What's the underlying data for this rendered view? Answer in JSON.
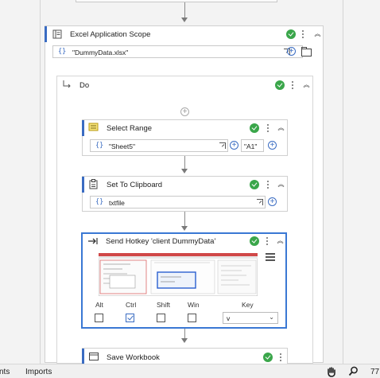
{
  "colors": {
    "accent": "#3a6cc2",
    "success": "#3aa64a",
    "selected_border": "#3a78d4"
  },
  "excel_scope": {
    "title": "Excel Application Scope",
    "path_value": "\"DummyData.xlsx\"",
    "brace": "{}"
  },
  "do_block": {
    "title": "Do"
  },
  "select_range": {
    "title": "Select Range",
    "sheet_value": "\"Sheet5\"",
    "range_value": "\"A1\"",
    "brace": "{}"
  },
  "set_to_clipboard": {
    "title": "Set To Clipboard",
    "text_value": "txtfile",
    "brace": "{}"
  },
  "send_hotkey": {
    "title": "Send Hotkey 'client  DummyData'",
    "modifiers": [
      {
        "label": "Alt",
        "checked": false
      },
      {
        "label": "Ctrl",
        "checked": true
      },
      {
        "label": "Shift",
        "checked": false
      },
      {
        "label": "Win",
        "checked": false
      }
    ],
    "key_label": "Key",
    "key_value": "v"
  },
  "save_workbook": {
    "title": "Save Workbook"
  },
  "status_bar": {
    "tab_partial": "nts",
    "imports": "Imports",
    "zoom_partial": "77"
  }
}
